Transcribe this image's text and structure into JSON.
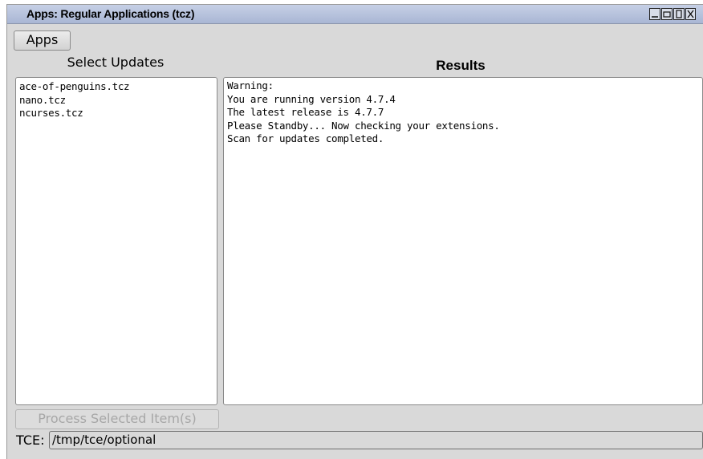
{
  "window": {
    "title": "Apps: Regular Applications (tcz)",
    "controls": [
      "minimize-icon",
      "restore-icon",
      "maximize-icon",
      "close-icon"
    ]
  },
  "toolbar": {
    "apps_label": "Apps"
  },
  "left_panel": {
    "heading": "Select Updates",
    "items": [
      "ace-of-penguins.tcz",
      "nano.tcz",
      "ncurses.tcz"
    ],
    "process_label": "Process Selected Item(s)"
  },
  "results": {
    "heading": "Results",
    "lines": [
      "Warning:",
      "You are running version 4.7.4",
      "The latest release is 4.7.7",
      "Please Standby... Now checking your extensions.",
      "Scan for updates completed."
    ]
  },
  "tce": {
    "label": "TCE:",
    "value": "/tmp/tce/optional"
  }
}
